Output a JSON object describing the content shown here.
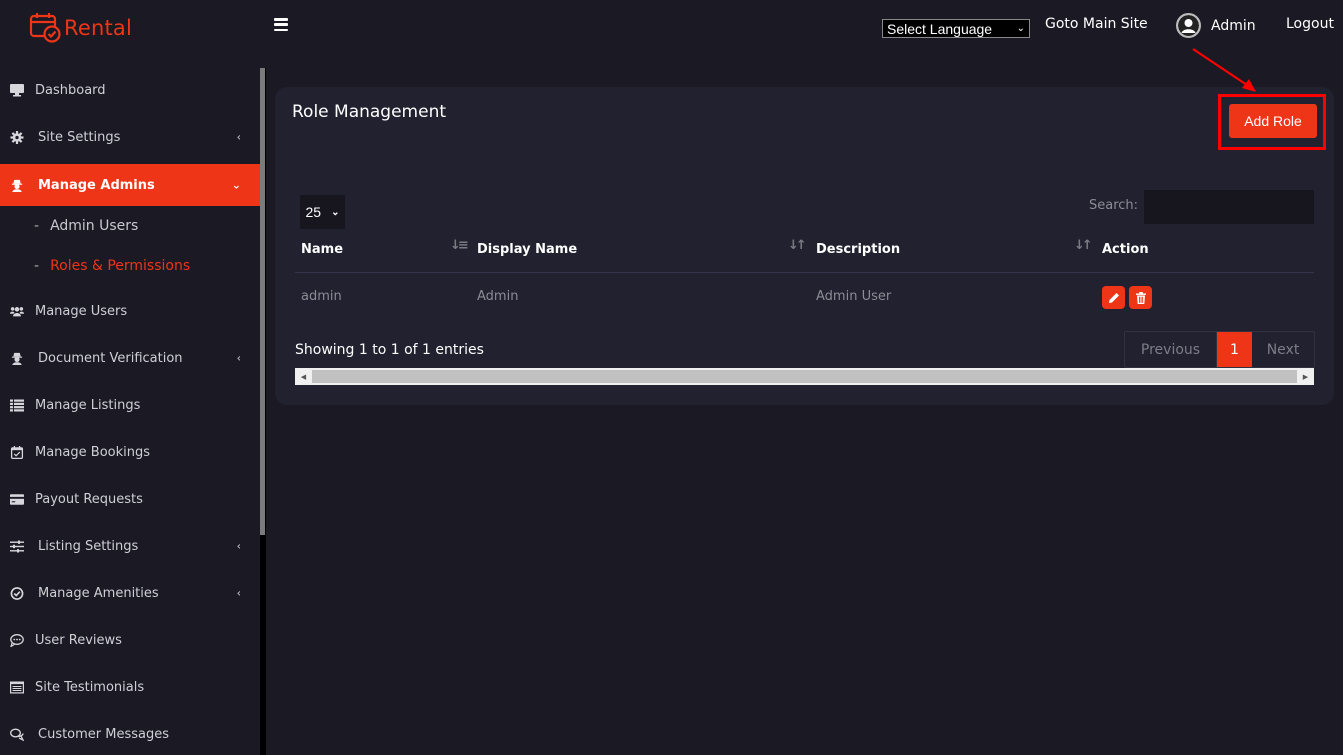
{
  "app": {
    "brand": "Rental",
    "brand_color": "#ee3517"
  },
  "topbar": {
    "language_select": {
      "selected": "Select Language"
    },
    "goto_main_site": "Goto Main Site",
    "user_name": "Admin",
    "logout": "Logout"
  },
  "sidebar": {
    "items": [
      {
        "label": "Dashboard",
        "icon": "monitor-icon",
        "has_caret": false
      },
      {
        "label": "Site Settings",
        "icon": "gear-icon",
        "has_caret": true
      },
      {
        "label": "Manage Admins",
        "icon": "user-secret-icon",
        "has_caret": true,
        "active": true,
        "expanded": true
      },
      {
        "label": "Manage Users",
        "icon": "users-icon",
        "has_caret": false
      },
      {
        "label": "Document Verification",
        "icon": "user-secret-icon",
        "has_caret": true
      },
      {
        "label": "Manage Listings",
        "icon": "list-icon",
        "has_caret": false
      },
      {
        "label": "Manage Bookings",
        "icon": "calendar-check-icon",
        "has_caret": false
      },
      {
        "label": "Payout Requests",
        "icon": "credit-card-icon",
        "has_caret": false
      },
      {
        "label": "Listing Settings",
        "icon": "sliders-icon",
        "has_caret": true
      },
      {
        "label": "Manage Amenities",
        "icon": "check-circle-icon",
        "has_caret": true
      },
      {
        "label": "User Reviews",
        "icon": "comment-dots-icon",
        "has_caret": false
      },
      {
        "label": "Site Testimonials",
        "icon": "list-alt-icon",
        "has_caret": false
      },
      {
        "label": "Customer Messages",
        "icon": "comments-icon",
        "has_caret": false
      }
    ],
    "submenu": [
      {
        "label": "Admin Users",
        "current": false
      },
      {
        "label": "Roles & Permissions",
        "current": true
      }
    ]
  },
  "main": {
    "title": "Role Management",
    "add_button": "Add Role",
    "page_length": "25",
    "search_label": "Search:",
    "search_value": "",
    "table": {
      "columns": [
        "Name",
        "Display Name",
        "Description",
        "Action"
      ],
      "rows": [
        {
          "name": "admin",
          "display_name": "Admin",
          "description": "Admin User"
        }
      ]
    },
    "info": "Showing 1 to 1 of 1 entries",
    "pagination": {
      "previous": "Previous",
      "current_page": "1",
      "next": "Next"
    }
  }
}
